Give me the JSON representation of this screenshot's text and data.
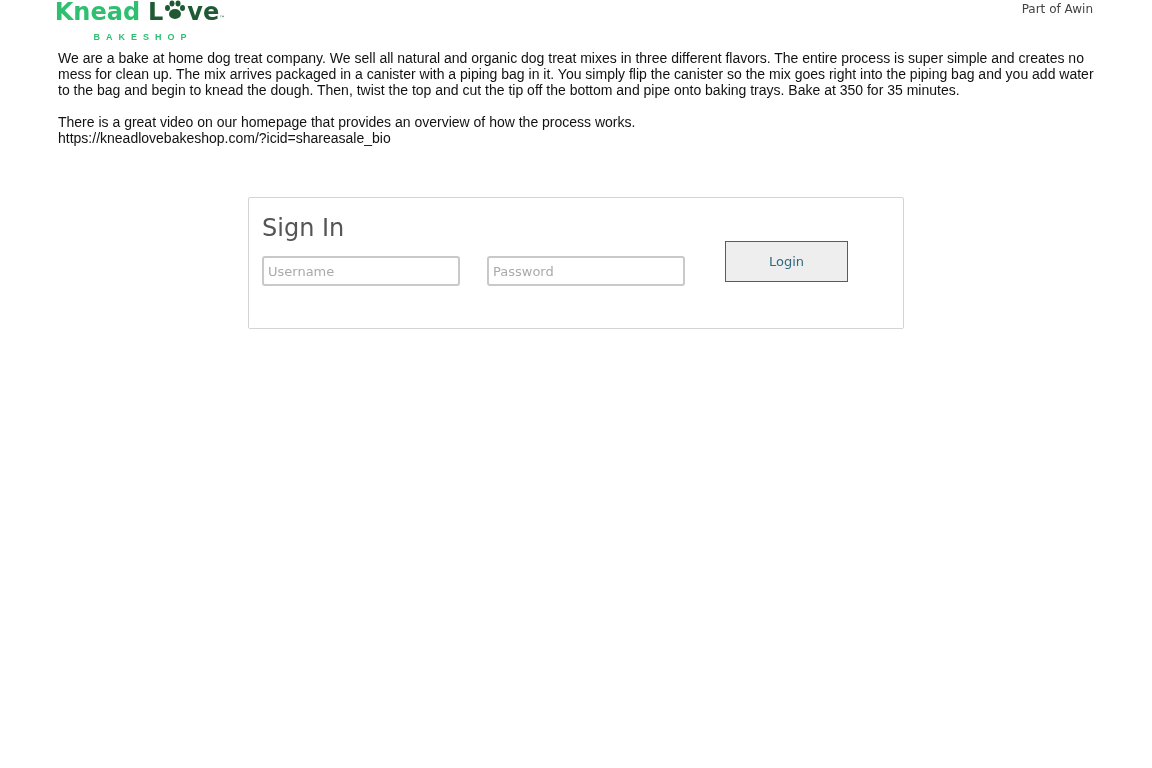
{
  "header": {
    "logo": {
      "word_1": "Knead",
      "word_2_start": "L",
      "word_2_end": "ve",
      "trademark": "™",
      "tagline": "BAKESHOP"
    },
    "network_label": "Part of Awin"
  },
  "description": [
    "We are a bake at home dog treat company. We sell all natural and organic dog treat mixes in three different flavors. The entire process is super simple and creates no mess for clean up. The mix arrives packaged in a canister with a piping bag in it. You simply flip the canister so the mix goes right into the piping bag and you add water to the bag and begin to knead the dough. Then, twist the top and cut the tip off the bottom and pipe onto baking trays. Bake at 350 for 35 minutes.",
    "There is a great video on our homepage that provides an overview of how the process works.\nhttps://kneadlovebakeshop.com/?icid=shareasale_bio"
  ],
  "sign_in": {
    "title": "Sign In",
    "username": {
      "placeholder": "Username"
    },
    "password": {
      "placeholder": "Password"
    },
    "button": "Login"
  }
}
